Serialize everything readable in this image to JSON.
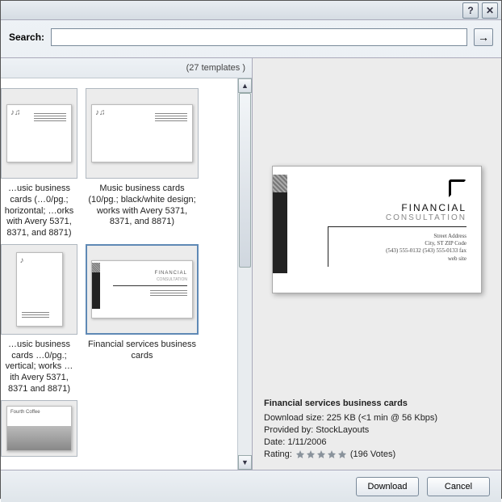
{
  "titlebar": {
    "help": "?",
    "close": "✕"
  },
  "search": {
    "label": "Search:",
    "value": "",
    "go": "→"
  },
  "count_text": "(27 templates )",
  "templates": [
    {
      "caption": "…usic business cards (…0/pg.; horizontal; …orks with Avery 5371, 8371, and 8871)"
    },
    {
      "caption": "Music business cards (10/pg.; black/white design; works with Avery 5371, 8371, and 8871)"
    },
    {
      "caption": "…usic business cards …0/pg.; vertical; works …ith Avery 5371, 8371 and 8871)"
    },
    {
      "caption": "Financial services business cards"
    },
    {
      "caption": ""
    }
  ],
  "preview": {
    "brand1": "FINANCIAL",
    "brand2": "CONSULTATION",
    "addr1": "Street Address",
    "addr2": "City, ST ZIP Code",
    "addr3": "(543) 555-0132 (543) 555-0133 fax",
    "addr4": "web site"
  },
  "meta": {
    "title": "Financial services business cards",
    "dl_label": "Download size:",
    "dl_value": "225 KB (<1 min @ 56 Kbps)",
    "prov_label": "Provided by:",
    "prov_value": "StockLayouts",
    "date_label": "Date:",
    "date_value": "1/11/2006",
    "rating_label": "Rating:",
    "votes": "(196 Votes)"
  },
  "buttons": {
    "download": "Download",
    "cancel": "Cancel"
  }
}
